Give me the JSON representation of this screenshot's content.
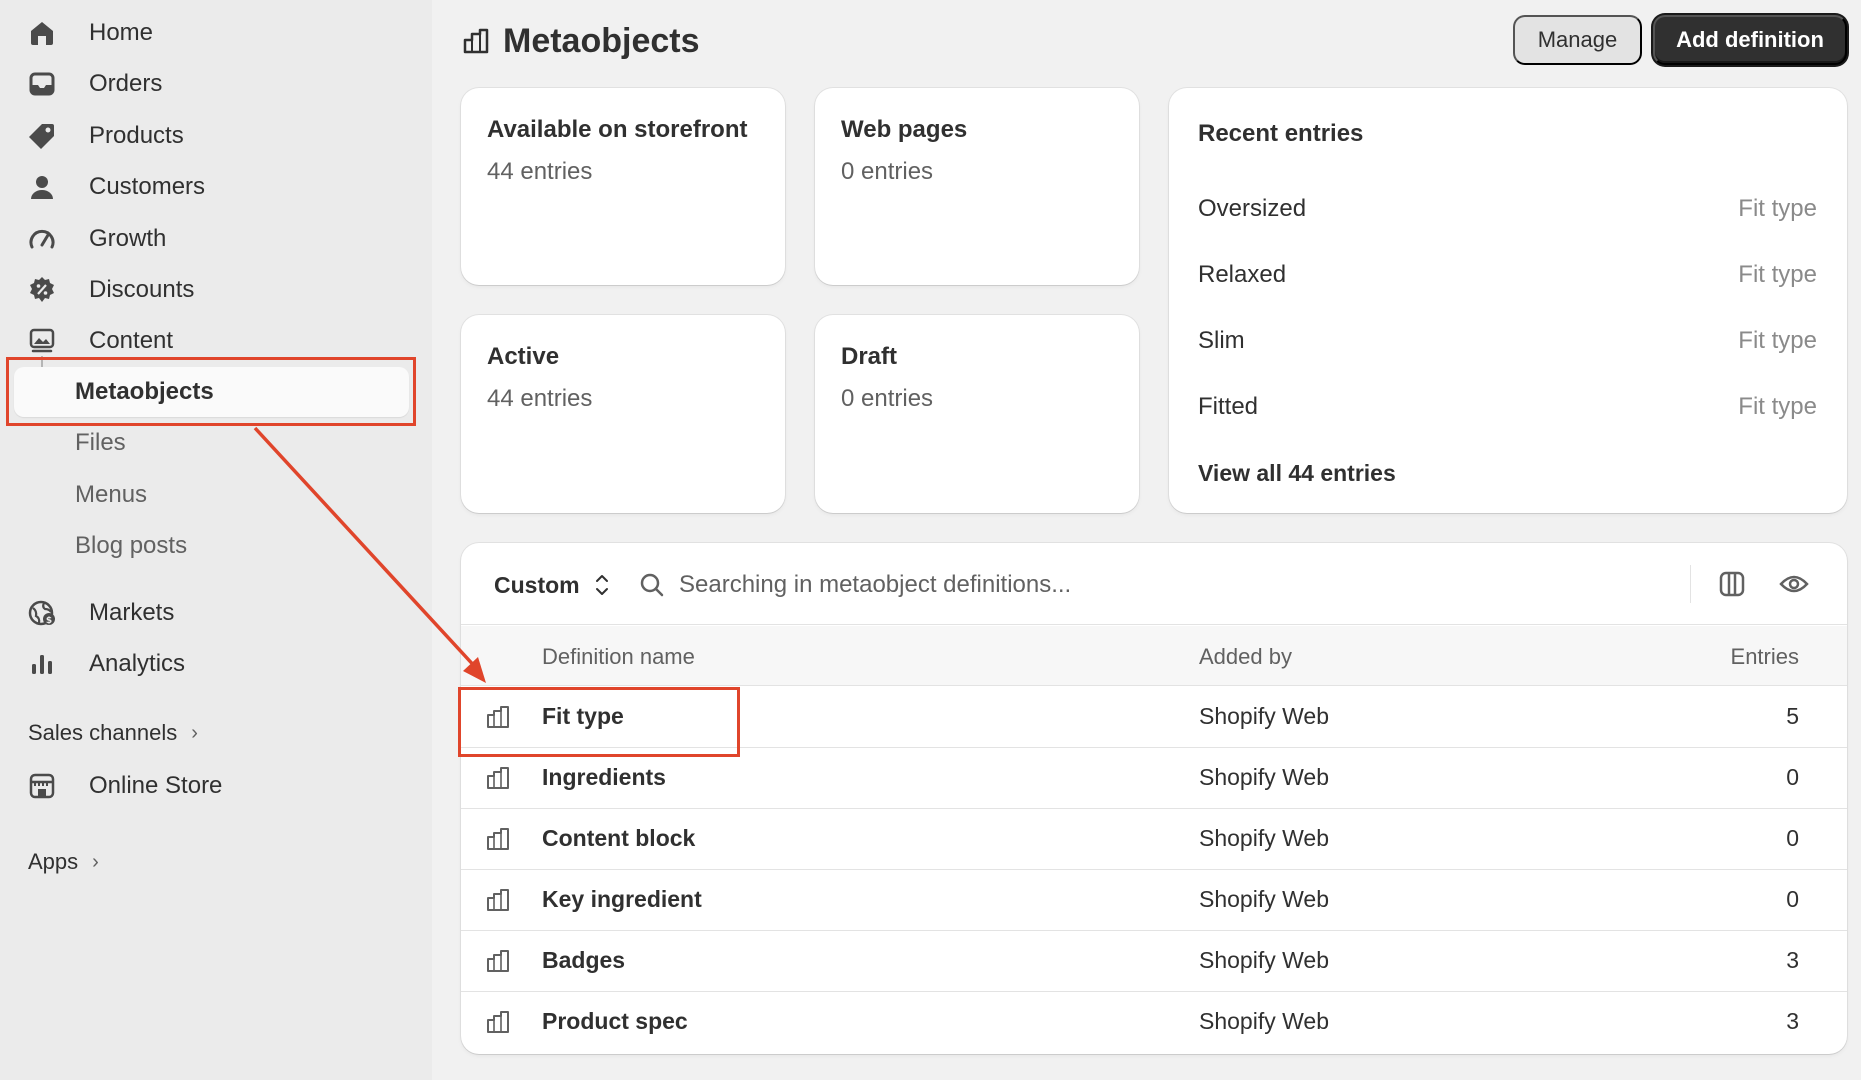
{
  "sidebar": {
    "items": [
      {
        "label": "Home",
        "icon": "home-icon"
      },
      {
        "label": "Orders",
        "icon": "inbox-icon"
      },
      {
        "label": "Products",
        "icon": "tag-icon"
      },
      {
        "label": "Customers",
        "icon": "person-icon"
      },
      {
        "label": "Growth",
        "icon": "gauge-icon"
      },
      {
        "label": "Discounts",
        "icon": "discount-icon"
      },
      {
        "label": "Content",
        "icon": "image-icon"
      }
    ],
    "content_sub": [
      "Metaobjects",
      "Files",
      "Menus",
      "Blog posts"
    ],
    "items2": [
      {
        "label": "Markets",
        "icon": "globe-icon"
      },
      {
        "label": "Analytics",
        "icon": "bar-chart-icon"
      }
    ],
    "sales_channels_label": "Sales channels",
    "online_store_label": "Online Store",
    "apps_label": "Apps"
  },
  "header": {
    "title": "Metaobjects",
    "manage_label": "Manage",
    "add_label": "Add definition"
  },
  "stats": [
    {
      "title": "Available on storefront",
      "value": "44 entries"
    },
    {
      "title": "Web pages",
      "value": "0 entries"
    },
    {
      "title": "Active",
      "value": "44 entries"
    },
    {
      "title": "Draft",
      "value": "0 entries"
    }
  ],
  "recent": {
    "title": "Recent entries",
    "entries": [
      {
        "name": "Oversized",
        "type": "Fit type"
      },
      {
        "name": "Relaxed",
        "type": "Fit type"
      },
      {
        "name": "Slim",
        "type": "Fit type"
      },
      {
        "name": "Fitted",
        "type": "Fit type"
      }
    ],
    "view_all": "View all 44 entries"
  },
  "table": {
    "sort_label": "Custom",
    "search_placeholder": "Searching in metaobject definitions...",
    "columns": [
      "Definition name",
      "Added by",
      "Entries"
    ],
    "rows": [
      {
        "name": "Fit type",
        "added_by": "Shopify Web",
        "entries": "5"
      },
      {
        "name": "Ingredients",
        "added_by": "Shopify Web",
        "entries": "0"
      },
      {
        "name": "Content block",
        "added_by": "Shopify Web",
        "entries": "0"
      },
      {
        "name": "Key ingredient",
        "added_by": "Shopify Web",
        "entries": "0"
      },
      {
        "name": "Badges",
        "added_by": "Shopify Web",
        "entries": "3"
      },
      {
        "name": "Product spec",
        "added_by": "Shopify Web",
        "entries": "3"
      }
    ]
  },
  "colors": {
    "annotation": "#e0452b",
    "primary_button": "#303030",
    "sidebar_bg": "#ebebeb"
  }
}
